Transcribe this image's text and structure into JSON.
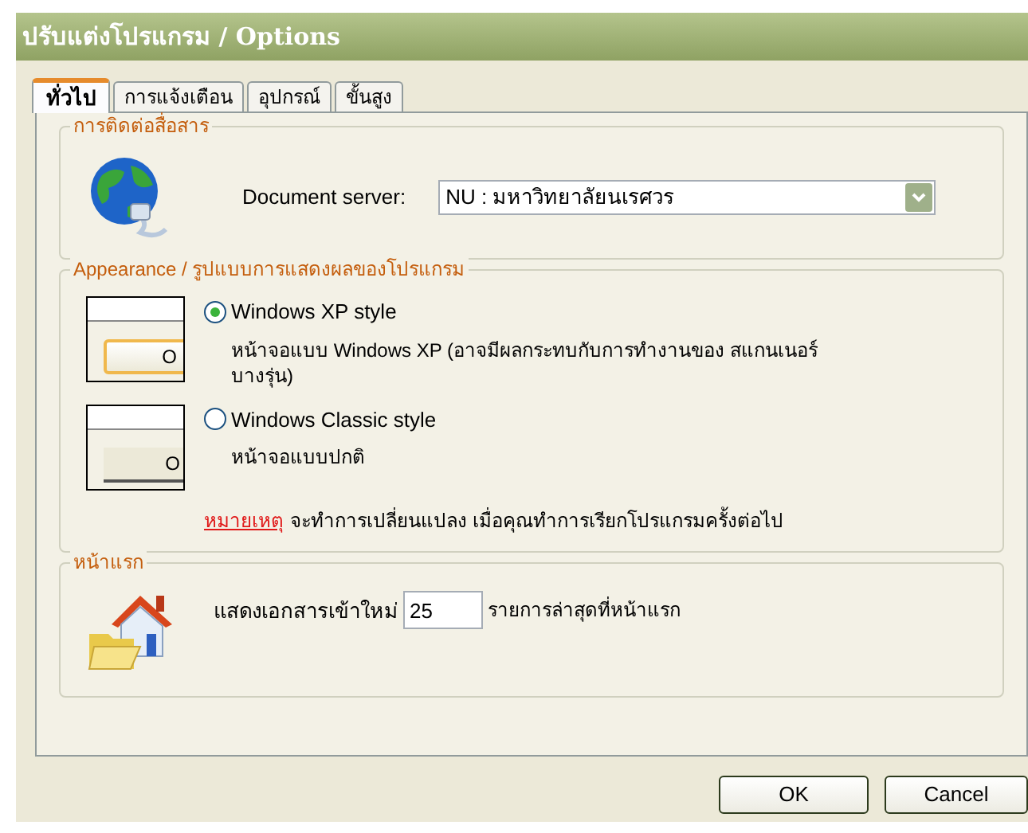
{
  "window": {
    "title": "ปรับแต่งโปรแกรม / Options"
  },
  "tabs": [
    {
      "label": "ทั่วไป",
      "selected": true
    },
    {
      "label": "การแจ้งเตือน",
      "selected": false
    },
    {
      "label": "อุปกรณ์",
      "selected": false
    },
    {
      "label": "ขั้นสูง",
      "selected": false
    }
  ],
  "communication": {
    "legend": "การติดต่อสื่อสาร",
    "server_label": "Document server:",
    "server_value": "NU : มหาวิทยาลัยนเรศวร"
  },
  "appearance": {
    "legend": "Appearance / รูปแบบการแสดงผลของโปรแกรม",
    "options": [
      {
        "kind": "xp",
        "label": "Windows XP style",
        "description": "หน้าจอแบบ Windows XP (อาจมีผลกระทบกับการทำงานของ สแกนเนอร์บางรุ่น)",
        "preview_button": "O",
        "selected": true
      },
      {
        "kind": "classic",
        "label": "Windows Classic style",
        "description": "หน้าจอแบบปกติ",
        "preview_button": "O",
        "selected": false
      }
    ],
    "note": {
      "link": "หมายเหตุ",
      "text": "จะทำการเปลี่ยนแปลง เมื่อคุณทำการเรียกโปรแกรมครั้งต่อไป"
    }
  },
  "home": {
    "legend": "หน้าแรก",
    "label_before": "แสดงเอกสารเข้าใหม่",
    "value": "25",
    "label_after": "รายการล่าสุดที่หน้าแรก"
  },
  "buttons": [
    "OK",
    "Cancel"
  ]
}
